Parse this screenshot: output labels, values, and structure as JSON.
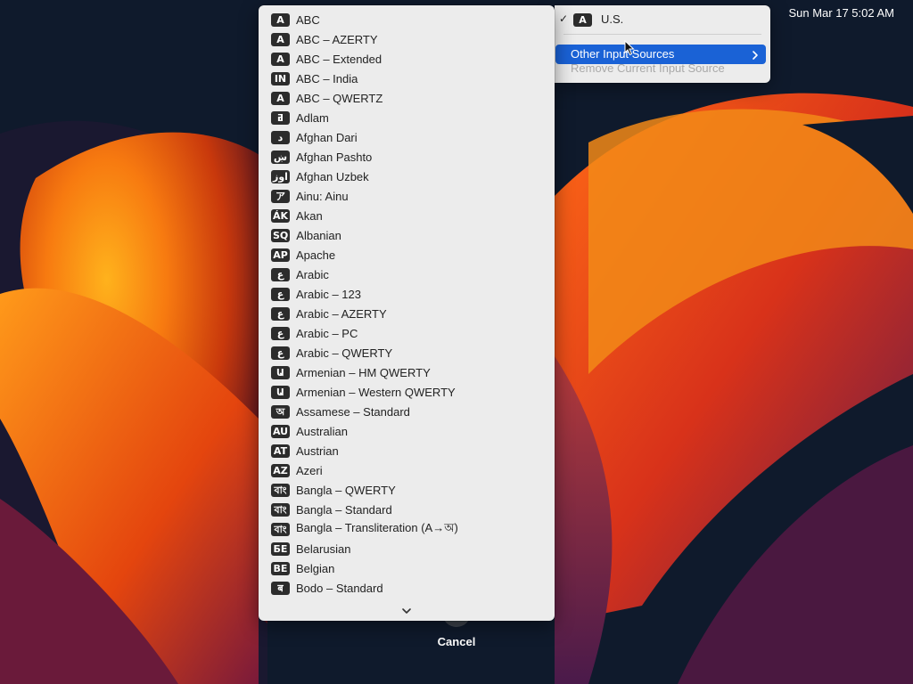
{
  "clock": "Sun Mar 17  5:02 AM",
  "input_sources": [
    {
      "badge": "A",
      "label": "ABC"
    },
    {
      "badge": "A",
      "label": "ABC – AZERTY"
    },
    {
      "badge": "A",
      "label": "ABC – Extended"
    },
    {
      "badge": "IN",
      "label": "ABC – India"
    },
    {
      "badge": "A",
      "label": "ABC – QWERTZ"
    },
    {
      "badge": "ߥ",
      "label": "Adlam"
    },
    {
      "badge": "د",
      "label": "Afghan Dari"
    },
    {
      "badge": "ښ",
      "label": "Afghan Pashto"
    },
    {
      "badge": "اوز",
      "label": "Afghan Uzbek"
    },
    {
      "badge": "ア",
      "label": "Ainu: Ainu"
    },
    {
      "badge": "ÁK",
      "label": "Akan"
    },
    {
      "badge": "SQ",
      "label": "Albanian"
    },
    {
      "badge": "AP",
      "label": "Apache"
    },
    {
      "badge": "ع",
      "label": "Arabic"
    },
    {
      "badge": "ع",
      "label": "Arabic – 123"
    },
    {
      "badge": "ع",
      "label": "Arabic – AZERTY"
    },
    {
      "badge": "ع",
      "label": "Arabic – PC"
    },
    {
      "badge": "ع",
      "label": "Arabic – QWERTY"
    },
    {
      "badge": "Ա",
      "label": "Armenian – HM QWERTY"
    },
    {
      "badge": "Ա",
      "label": "Armenian – Western QWERTY"
    },
    {
      "badge": "অ",
      "label": "Assamese – Standard"
    },
    {
      "badge": "AU",
      "label": "Australian"
    },
    {
      "badge": "AT",
      "label": "Austrian"
    },
    {
      "badge": "AZ",
      "label": "Azeri"
    },
    {
      "badge": "বাং",
      "label": "Bangla – QWERTY"
    },
    {
      "badge": "বাং",
      "label": "Bangla – Standard"
    },
    {
      "badge": "বাং",
      "label": "Bangla – Transliteration (A→অ)"
    },
    {
      "badge": "БЕ",
      "label": "Belarusian"
    },
    {
      "badge": "BE",
      "label": "Belgian"
    },
    {
      "badge": "ब",
      "label": "Bodo – Standard"
    }
  ],
  "input_menu": {
    "current_badge": "A",
    "current_label": "U.S.",
    "other_sources_label": "Other Input Sources",
    "remove_label": "Remove Current Input Source"
  },
  "cancel_label": "Cancel",
  "colors": {
    "menu_bg": "#ececec",
    "highlight": "#1a62d6",
    "badge_bg": "#2c2c2c",
    "disabled_text": "#a9a9a9"
  }
}
